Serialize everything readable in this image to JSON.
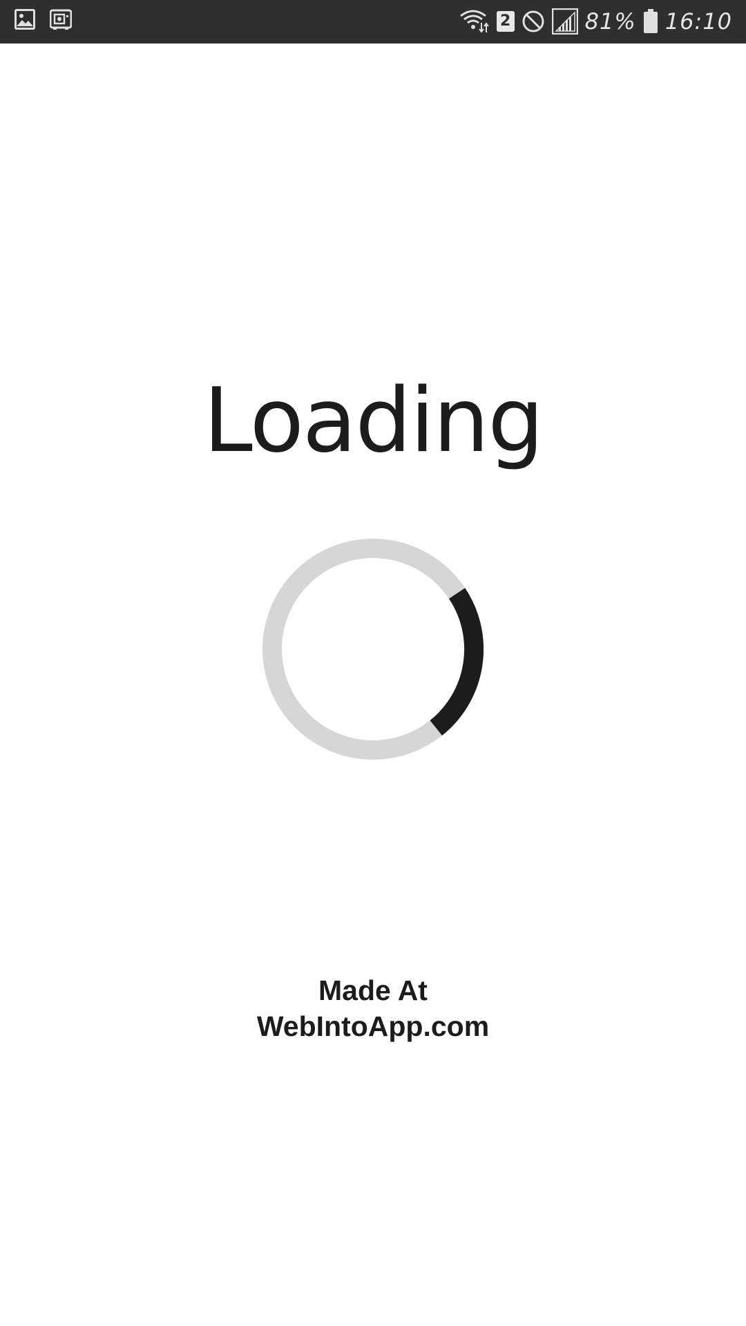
{
  "status_bar": {
    "left_icons": [
      "image-notification-icon",
      "safe-notification-icon"
    ],
    "right_icons": [
      "wifi-data-icon",
      "sim-badge",
      "do-not-disturb-icon",
      "signal-icon",
      "battery-icon"
    ],
    "sim_badge": "2",
    "battery_percent": "81%",
    "time": "16:10",
    "background_color": "#2f2f2f"
  },
  "main": {
    "title": "Loading",
    "progress_arc_color": "#1c1c1c",
    "track_color": "#d6d6d6",
    "credit_line1": "Made At",
    "credit_line2": "WebIntoApp.com"
  }
}
